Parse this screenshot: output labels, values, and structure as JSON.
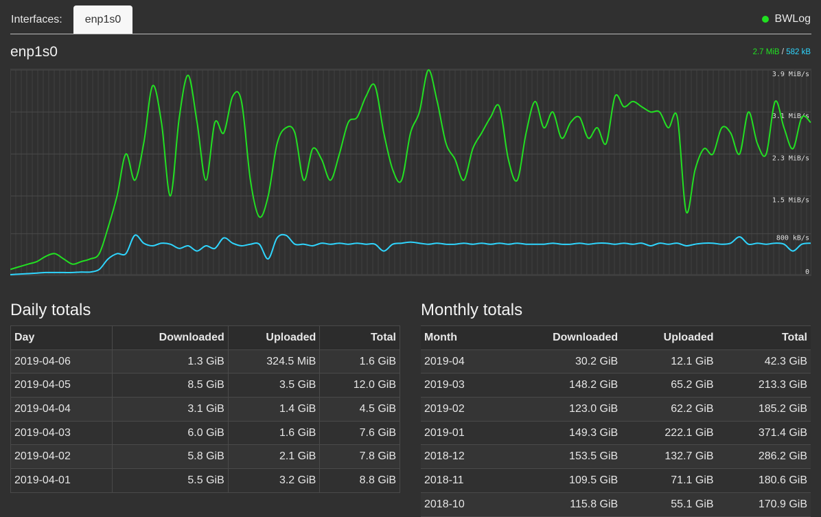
{
  "topbar": {
    "interfaces_label": "Interfaces:",
    "active_tab": "enp1s0",
    "brand": "BWLog",
    "status_color": "#20e020"
  },
  "interface": {
    "name": "enp1s0",
    "download_rate": "2.7 MiB",
    "separator": "/",
    "upload_rate": "582 kB"
  },
  "chart_data": {
    "type": "line",
    "yticks": [
      "3.9 MiB/s",
      "3.1 MiB/s",
      "2.3 MiB/s",
      "1.5 MiB/s",
      "800 kB/s",
      "0"
    ],
    "ytick_values_mib": [
      3.9,
      3.1,
      2.3,
      1.5,
      0.78,
      0
    ],
    "ylim": [
      0,
      3.9
    ],
    "grid": true,
    "series": [
      {
        "color": "#22e022",
        "values": [
          0.1,
          0.15,
          0.2,
          0.25,
          0.35,
          0.4,
          0.3,
          0.2,
          0.25,
          0.3,
          0.4,
          0.9,
          1.5,
          2.3,
          1.8,
          2.5,
          3.6,
          2.9,
          1.5,
          3.0,
          3.8,
          2.9,
          1.8,
          2.9,
          2.7,
          3.4,
          3.3,
          1.8,
          1.1,
          1.5,
          2.5,
          2.8,
          2.7,
          1.8,
          2.4,
          2.2,
          1.8,
          2.3,
          2.9,
          3.0,
          3.4,
          3.6,
          2.7,
          2.0,
          1.8,
          2.7,
          3.1,
          3.9,
          3.3,
          2.5,
          2.2,
          1.8,
          2.4,
          2.7,
          3.0,
          3.2,
          2.2,
          1.8,
          2.7,
          3.3,
          2.8,
          3.1,
          2.6,
          2.9,
          3.0,
          2.6,
          2.8,
          2.5,
          3.4,
          3.2,
          3.3,
          3.2,
          3.1,
          3.1,
          2.8,
          3.0,
          1.2,
          2.0,
          2.4,
          2.3,
          2.8,
          2.7,
          2.3,
          3.1,
          2.5,
          2.3,
          3.3,
          2.8,
          2.4,
          3.0,
          2.9
        ]
      },
      {
        "color": "#2fd6ff",
        "values": [
          0.0,
          0.01,
          0.02,
          0.03,
          0.04,
          0.04,
          0.04,
          0.04,
          0.05,
          0.05,
          0.1,
          0.3,
          0.4,
          0.4,
          0.75,
          0.6,
          0.55,
          0.6,
          0.58,
          0.5,
          0.55,
          0.45,
          0.55,
          0.5,
          0.7,
          0.6,
          0.55,
          0.58,
          0.58,
          0.3,
          0.7,
          0.75,
          0.58,
          0.58,
          0.55,
          0.6,
          0.58,
          0.6,
          0.58,
          0.6,
          0.58,
          0.58,
          0.45,
          0.58,
          0.6,
          0.62,
          0.6,
          0.58,
          0.6,
          0.58,
          0.58,
          0.6,
          0.58,
          0.6,
          0.58,
          0.6,
          0.58,
          0.6,
          0.58,
          0.58,
          0.58,
          0.6,
          0.58,
          0.58,
          0.6,
          0.58,
          0.6,
          0.6,
          0.58,
          0.6,
          0.58,
          0.6,
          0.55,
          0.6,
          0.58,
          0.6,
          0.55,
          0.58,
          0.6,
          0.6,
          0.58,
          0.6,
          0.72,
          0.58,
          0.6,
          0.58,
          0.6,
          0.58,
          0.45,
          0.58,
          0.6
        ]
      }
    ]
  },
  "daily": {
    "heading": "Daily totals",
    "columns": [
      "Day",
      "Downloaded",
      "Uploaded",
      "Total"
    ],
    "rows": [
      [
        "2019-04-06",
        "1.3 GiB",
        "324.5 MiB",
        "1.6 GiB"
      ],
      [
        "2019-04-05",
        "8.5 GiB",
        "3.5 GiB",
        "12.0 GiB"
      ],
      [
        "2019-04-04",
        "3.1 GiB",
        "1.4 GiB",
        "4.5 GiB"
      ],
      [
        "2019-04-03",
        "6.0 GiB",
        "1.6 GiB",
        "7.6 GiB"
      ],
      [
        "2019-04-02",
        "5.8 GiB",
        "2.1 GiB",
        "7.8 GiB"
      ],
      [
        "2019-04-01",
        "5.5 GiB",
        "3.2 GiB",
        "8.8 GiB"
      ]
    ]
  },
  "monthly": {
    "heading": "Monthly totals",
    "columns": [
      "Month",
      "Downloaded",
      "Uploaded",
      "Total"
    ],
    "rows": [
      [
        "2019-04",
        "30.2 GiB",
        "12.1 GiB",
        "42.3 GiB"
      ],
      [
        "2019-03",
        "148.2 GiB",
        "65.2 GiB",
        "213.3 GiB"
      ],
      [
        "2019-02",
        "123.0 GiB",
        "62.2 GiB",
        "185.2 GiB"
      ],
      [
        "2019-01",
        "149.3 GiB",
        "222.1 GiB",
        "371.4 GiB"
      ],
      [
        "2018-12",
        "153.5 GiB",
        "132.7 GiB",
        "286.2 GiB"
      ],
      [
        "2018-11",
        "109.5 GiB",
        "71.1 GiB",
        "180.6 GiB"
      ],
      [
        "2018-10",
        "115.8 GiB",
        "55.1 GiB",
        "170.9 GiB"
      ]
    ]
  }
}
